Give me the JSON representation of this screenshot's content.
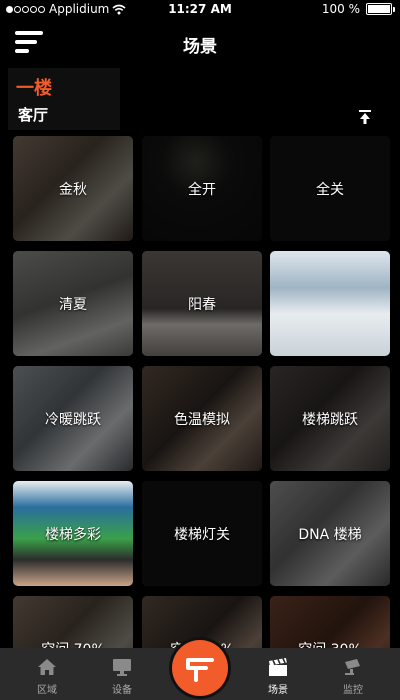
{
  "status_bar": {
    "carrier": "Applidium",
    "time": "11:27 AM",
    "battery": "100 %"
  },
  "nav": {
    "title": "场景"
  },
  "floor": {
    "name": "一楼",
    "room": "客厅"
  },
  "scenes": [
    {
      "label": "金秋",
      "bg": "photo-office"
    },
    {
      "label": "全开",
      "bg": "dark-bulb"
    },
    {
      "label": "全关",
      "bg": "dark"
    },
    {
      "label": "清夏",
      "bg": "photo-desk"
    },
    {
      "label": "阳春",
      "bg": "photo-tv"
    },
    {
      "label": "",
      "bg": "photo-handshake"
    },
    {
      "label": "冷暖跳跃",
      "bg": "photo-meeting"
    },
    {
      "label": "色温模拟",
      "bg": "photo-people"
    },
    {
      "label": "楼梯跳跃",
      "bg": "photo-table"
    },
    {
      "label": "楼梯多彩",
      "bg": "photo-game"
    },
    {
      "label": "楼梯灯关",
      "bg": "dark"
    },
    {
      "label": "DNA 楼梯",
      "bg": "photo-whiteboard"
    },
    {
      "label": "空间 70%",
      "bg": "photo-office"
    },
    {
      "label": "空间 50%",
      "bg": "photo-people"
    },
    {
      "label": "空间 30%",
      "bg": "photo-brick"
    }
  ],
  "tabs": [
    {
      "label": "区域",
      "icon": "home-icon"
    },
    {
      "label": "设备",
      "icon": "monitor-icon"
    },
    {
      "label": "场景",
      "icon": "clapper-icon",
      "active": true
    },
    {
      "label": "监控",
      "icon": "camera-icon"
    }
  ],
  "colors": {
    "accent": "#f25c2a",
    "tabbar": "#2b2b2b",
    "background": "#000000"
  }
}
